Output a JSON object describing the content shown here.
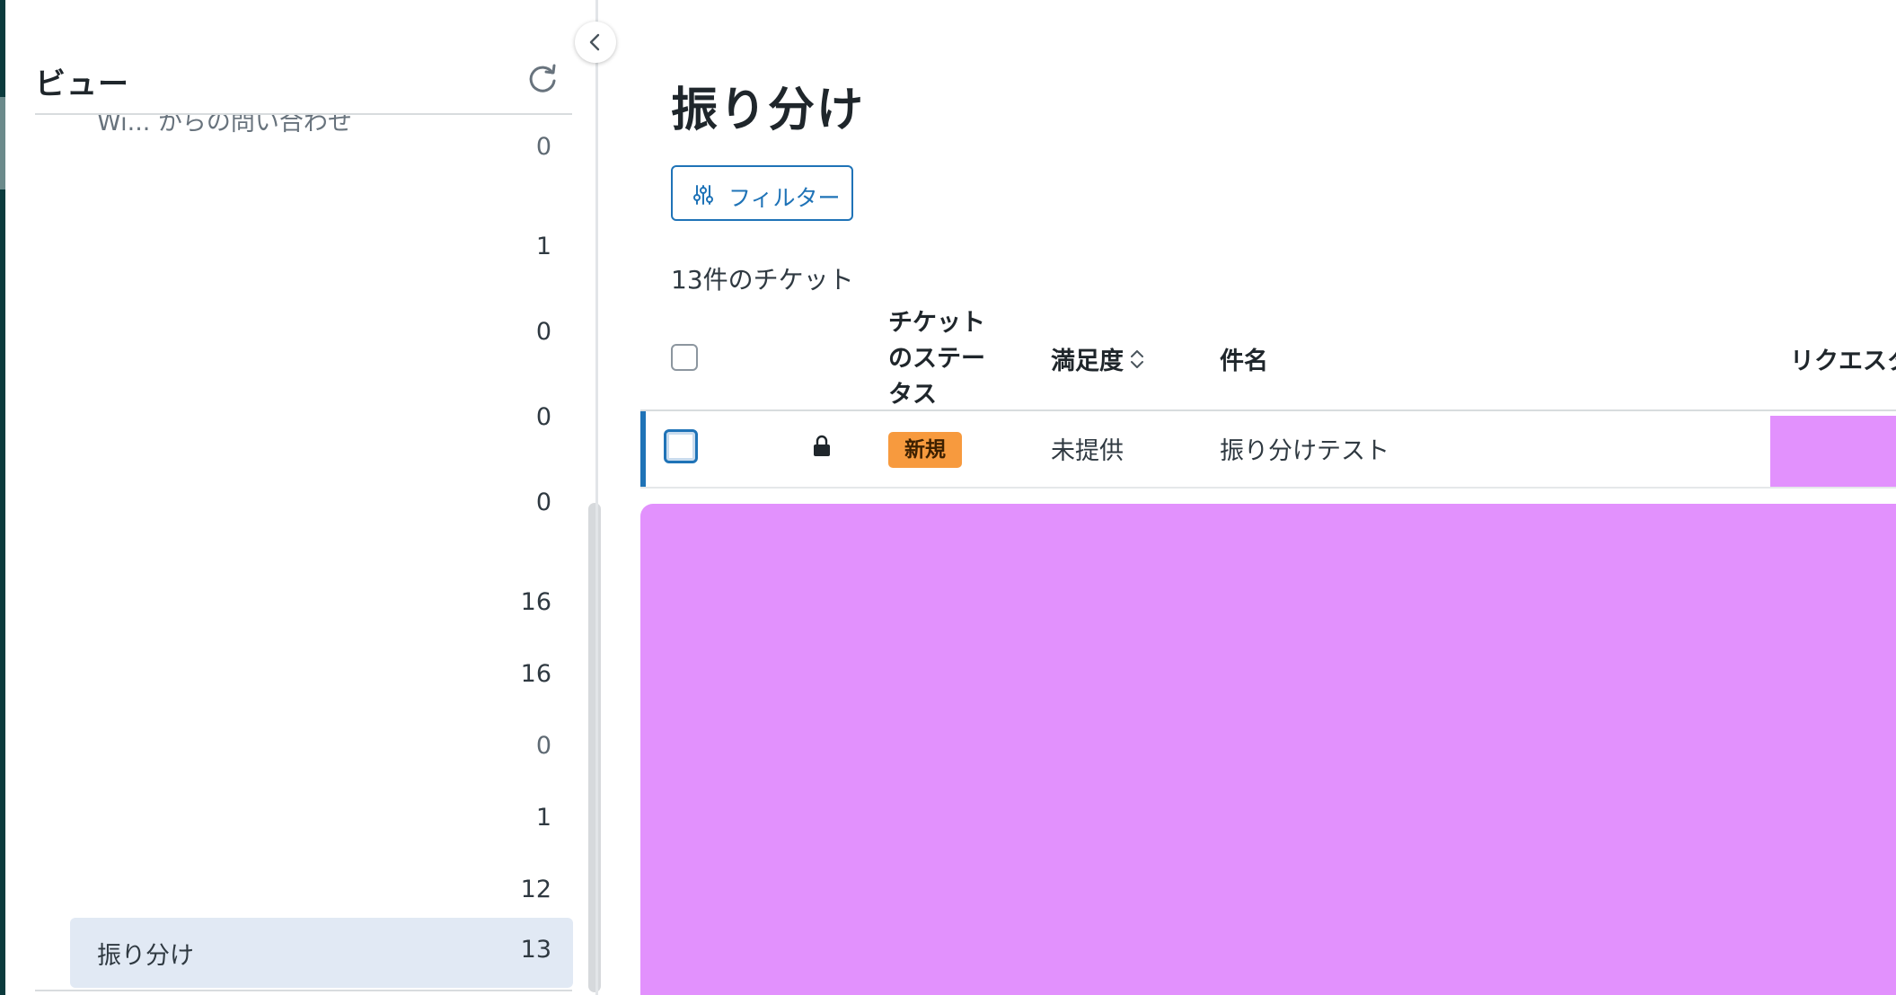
{
  "sidebar": {
    "title": "ビュー",
    "clipped_label": "Wi... からの問い合わせ",
    "views": [
      {
        "label": "",
        "count": "0",
        "muted": true
      },
      {
        "label": "",
        "count": "1"
      },
      {
        "label": "",
        "count": "0"
      },
      {
        "label": "",
        "count": "0"
      },
      {
        "label": "",
        "count": "0"
      },
      {
        "label": "",
        "count": "16"
      },
      {
        "label": "",
        "count": "16"
      },
      {
        "label": "",
        "count": "0",
        "muted": true
      },
      {
        "label": "",
        "count": "1"
      },
      {
        "label": "",
        "count": "12"
      },
      {
        "label": "振り分け",
        "count": "13",
        "selected": true
      }
    ]
  },
  "main": {
    "title": "振り分け",
    "filter_label": "フィルター",
    "ticket_count": "13件のチケット",
    "columns": {
      "status": "チケットのステータス",
      "satisfaction": "満足度",
      "subject": "件名",
      "requester": "リクエスタ"
    },
    "rows": [
      {
        "status": "新規",
        "satisfaction": "未提供",
        "subject": "振り分けテスト",
        "locked": true
      }
    ]
  },
  "colors": {
    "accent": "#1f73b7",
    "status_new": "#f79a3e",
    "redaction": "#e291fd",
    "selected_bg": "#e1e9f4"
  },
  "icons": [
    "refresh-icon",
    "chevron-left-icon",
    "filter-sliders-icon",
    "sort-icon",
    "lock-icon"
  ]
}
